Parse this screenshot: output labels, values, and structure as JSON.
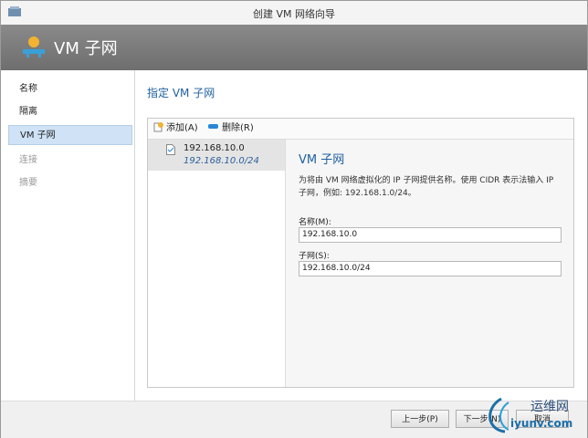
{
  "window": {
    "title": "创建 VM 网络向导"
  },
  "banner": {
    "title": "VM 子网"
  },
  "nav": {
    "items": [
      {
        "label": "名称",
        "state": "normal"
      },
      {
        "label": "隔离",
        "state": "normal"
      },
      {
        "label": "VM 子网",
        "state": "active"
      },
      {
        "label": "连接",
        "state": "disabled"
      },
      {
        "label": "摘要",
        "state": "disabled"
      }
    ]
  },
  "page": {
    "heading": "指定 VM 子网"
  },
  "toolbar": {
    "add_label": "添加(A)",
    "delete_label": "删除(R)"
  },
  "subnets": [
    {
      "name": "192.168.10.0",
      "range": "192.168.10.0/24"
    }
  ],
  "detail": {
    "title": "VM 子网",
    "description": "为将由 VM 网络虚拟化的 IP 子网提供名称。使用 CIDR 表示法输入 IP 子网，例如: 192.168.1.0/24。",
    "name_label": "名称(M):",
    "name_value": "192.168.10.0",
    "subnet_label": "子网(S):",
    "subnet_value": "192.168.10.0/24"
  },
  "footer": {
    "prev_label": "上一步(P)",
    "next_label": "下一步(N)",
    "cancel_label": "取消"
  },
  "watermark": {
    "cn": "运维网",
    "url": "iyunv.com"
  },
  "colors": {
    "accent": "#1e5f9e",
    "nav_active": "#cfe2f6",
    "banner": "#7a7a7a"
  }
}
